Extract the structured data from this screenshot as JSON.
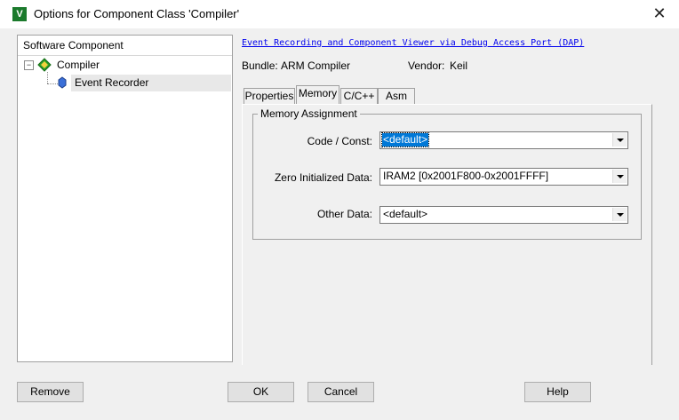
{
  "window": {
    "title": "Options for Component Class 'Compiler'",
    "icon_letter": "ᴠ",
    "close_glyph": "✕"
  },
  "tree": {
    "header": "Software Component",
    "root": {
      "label": "Compiler",
      "expander": "−"
    },
    "child": {
      "label": "Event Recorder"
    }
  },
  "details": {
    "link": "Event Recording and Component Viewer via Debug Access Port (DAP)",
    "bundle_label": "Bundle:",
    "bundle_value": "ARM Compiler",
    "vendor_label": "Vendor:",
    "vendor_value": "Keil"
  },
  "tabs": [
    "Properties",
    "Memory",
    "C/C++",
    "Asm"
  ],
  "active_tab": "Memory",
  "memory": {
    "group_title": "Memory Assignment",
    "code_label": "Code / Const:",
    "code_value": "<default>",
    "zero_label": "Zero Initialized Data:",
    "zero_value": "IRAM2 [0x2001F800-0x2001FFFF]",
    "other_label": "Other Data:",
    "other_value": "<default>"
  },
  "buttons": {
    "remove": "Remove",
    "ok": "OK",
    "cancel": "Cancel",
    "help": "Help"
  }
}
